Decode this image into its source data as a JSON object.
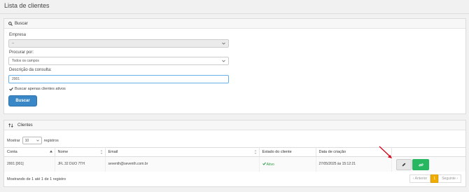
{
  "page": {
    "title": "Lista de clientes"
  },
  "search": {
    "header": "Buscar",
    "empresa_label": "Empresa",
    "empresa_value": "--",
    "procurar_label": "Procurar por:",
    "procurar_value": "Todos os campos",
    "descricao_label": "Descrição da consulta:",
    "descricao_value": "2001",
    "active_only_label": "Buscar apenas clientes ativos",
    "active_only_checked": true,
    "button_label": "Buscar"
  },
  "clients": {
    "header": "Clientes",
    "show_prefix": "Mostrar",
    "show_value": "10",
    "show_suffix": "registros",
    "columns": [
      "Conta",
      "Nome",
      "Email",
      "Estado do cliente",
      "Data de criação"
    ],
    "rows": [
      {
        "conta": "2001 [001]",
        "nome": "JFL 32 DUO 7TH",
        "email": "seventh@seventh.com.br",
        "estado": "Ativo",
        "data": "27/05/2025 às 15:12:21"
      }
    ],
    "footer_text": "Mostrando de 1 até 1 de 1 registro",
    "pagination": {
      "prev": "‹ Anterior",
      "current": "1",
      "next": "Seguinte ›"
    }
  },
  "colors": {
    "primary": "#3a87c7",
    "success": "#27b760",
    "pager_active": "#f0ad00",
    "arrow": "#d0021b"
  }
}
